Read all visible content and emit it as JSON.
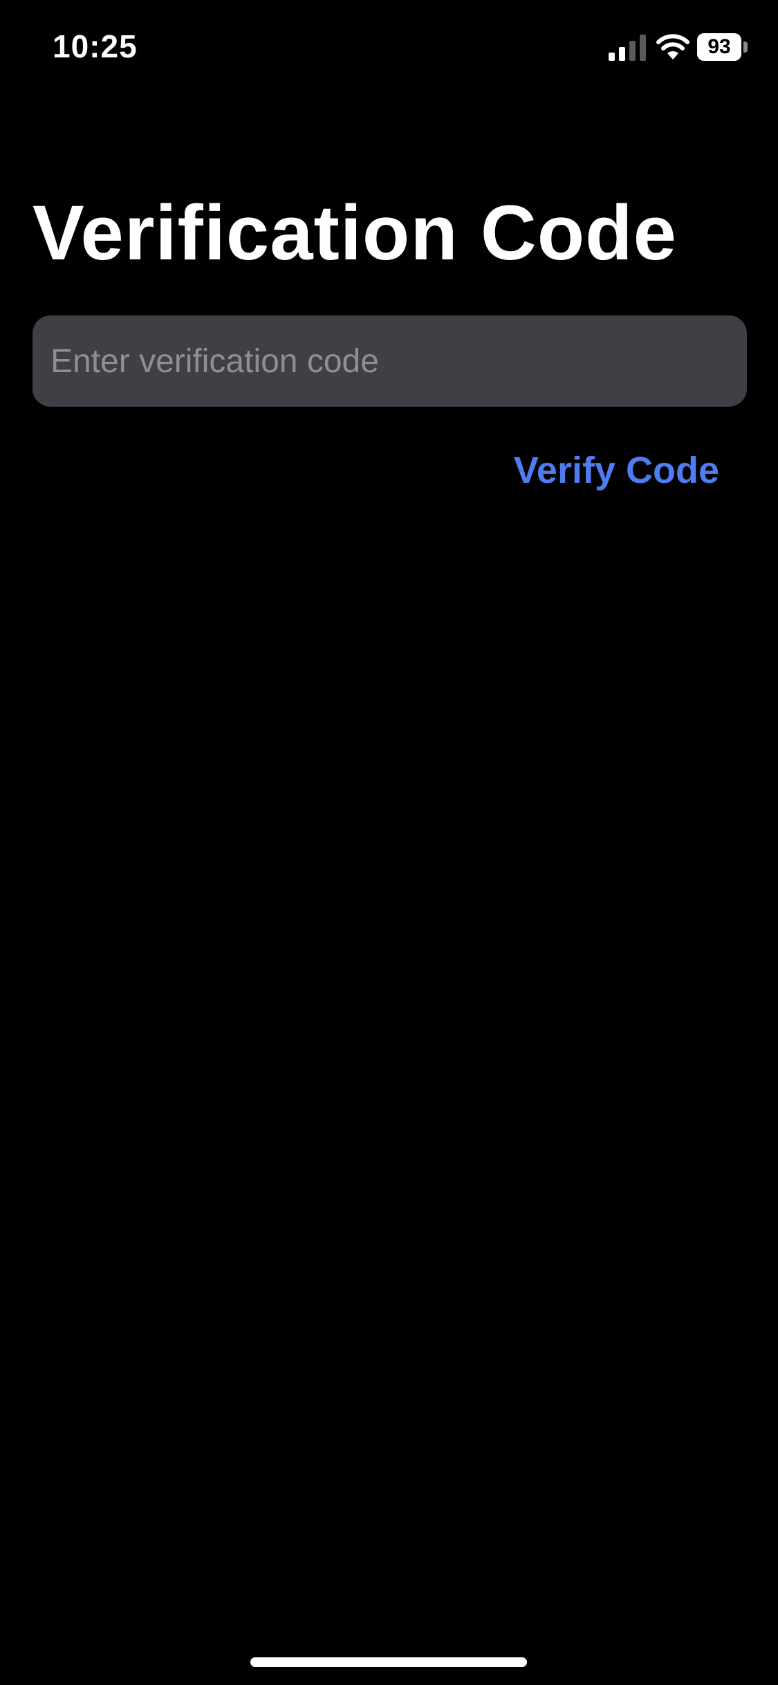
{
  "status_bar": {
    "time": "10:25",
    "battery_level": "93",
    "signal_icon": "cellular-signal-icon",
    "wifi_icon": "wifi-icon",
    "battery_icon": "battery-icon"
  },
  "page": {
    "title": "Verification Code"
  },
  "code_field": {
    "value": "",
    "placeholder": "Enter verification code"
  },
  "actions": {
    "verify_label": "Verify Code"
  },
  "colors": {
    "background": "#000000",
    "field_background": "#3f3f45",
    "placeholder": "#8e8e93",
    "accent": "#4f7cf0",
    "text": "#ffffff"
  }
}
